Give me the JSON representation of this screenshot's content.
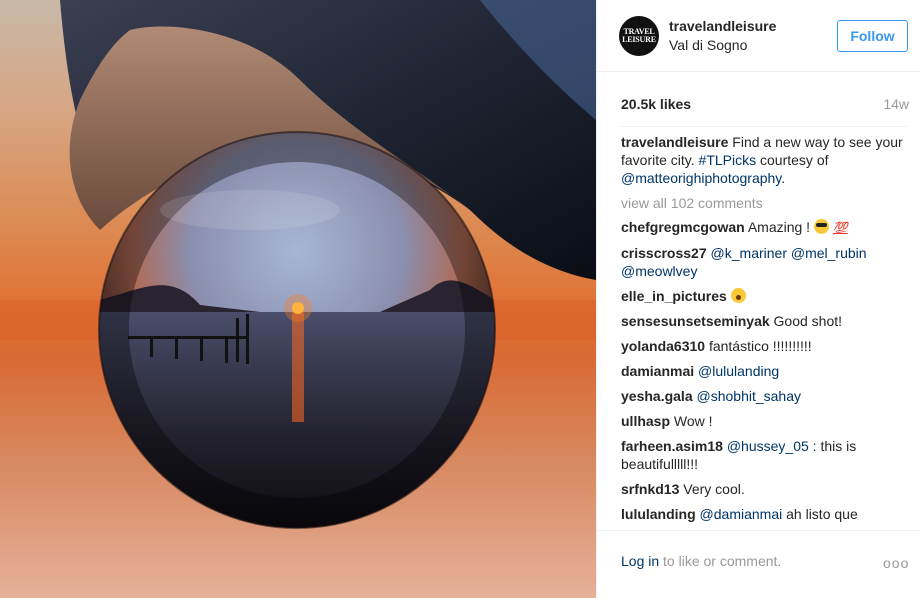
{
  "post": {
    "username": "travelandleisure",
    "location": "Val di Sogno",
    "avatar_text": [
      "TRAVEL",
      "LEISURE"
    ],
    "follow_label": "Follow",
    "likes": "20.5k likes",
    "age": "14w"
  },
  "caption": {
    "user": "travelandleisure",
    "text_1": "Find a new way to see your favorite city.",
    "hashtag": "#TLPicks",
    "text_2": "courtesy of",
    "mention": "@matteorighiphotography",
    "text_3": "."
  },
  "view_all_comments": "view all 102 comments",
  "comments": [
    {
      "user": "chefgregmcgowan",
      "text": "Amazing !"
    },
    {
      "user": "crisscross27",
      "mentions": [
        "@k_mariner",
        "@mel_rubin",
        "@meowlvey"
      ]
    },
    {
      "user": "elle_in_pictures",
      "text": ""
    },
    {
      "user": "sensesunsetseminyak",
      "text": "Good shot!"
    },
    {
      "user": "yolanda6310",
      "text": "fantástico !!!!!!!!!!"
    },
    {
      "user": "damianmai",
      "mention": "@lululanding"
    },
    {
      "user": "yesha.gala",
      "mention": "@shobhit_sahay"
    },
    {
      "user": "ullhasp",
      "text": "Wow !"
    },
    {
      "user": "farheen.asim18",
      "mention": "@hussey_05",
      "text": ": this is beautifulllll!!!"
    },
    {
      "user": "srfnkd13",
      "text": "Very cool."
    },
    {
      "user": "lululanding",
      "mention": "@damianmai",
      "text": "ah listo que"
    }
  ],
  "footer": {
    "login_link": "Log in",
    "login_text": "to like or comment.",
    "more_label": "ooo"
  },
  "icons": {
    "emoji_1": "sunglasses-emoji-icon",
    "emoji_2": "hundred-points-emoji-icon",
    "emoji_3": "surprised-face-emoji-icon",
    "more": "more-options-icon"
  },
  "colors": {
    "follow_blue": "#3897f0",
    "link_navy": "#003569",
    "muted": "#999999"
  }
}
